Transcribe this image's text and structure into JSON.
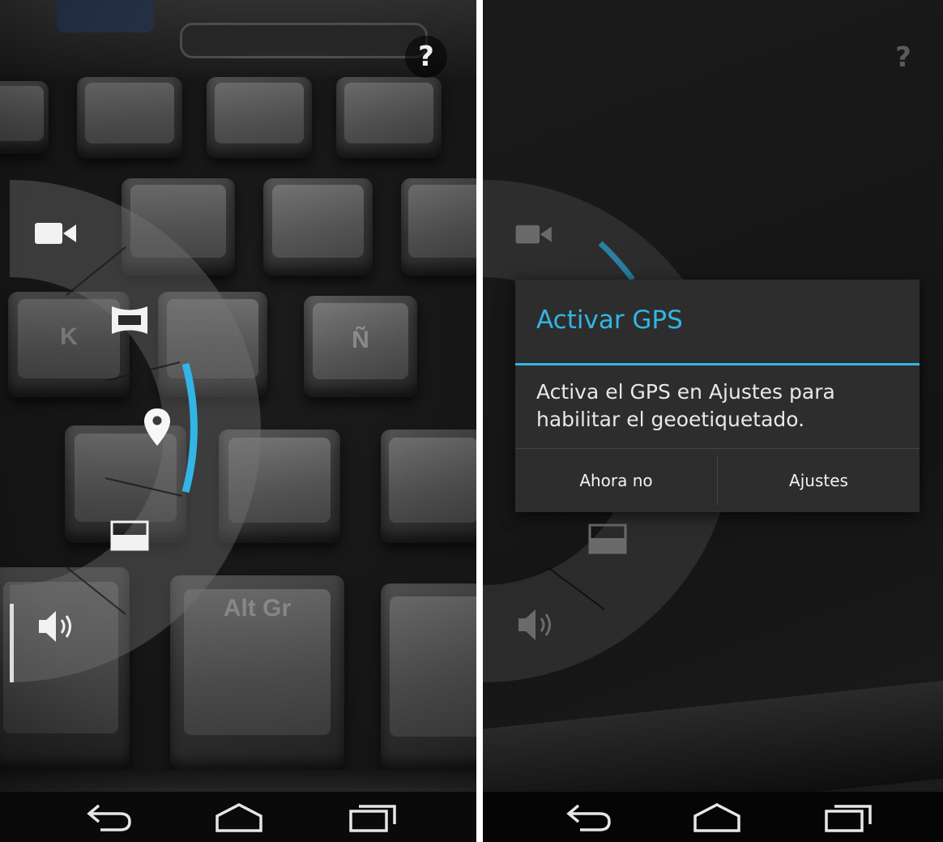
{
  "left_screen": {
    "help_label": "?",
    "keys": [
      "Alt Gr",
      "K",
      "Ñ"
    ],
    "menu_items": [
      {
        "name": "video-mode",
        "icon": "video-camera-icon"
      },
      {
        "name": "panorama-mode",
        "icon": "panorama-icon"
      },
      {
        "name": "geotag-toggle",
        "icon": "location-pin-icon",
        "active": true
      },
      {
        "name": "picture-size",
        "icon": "aspect-ratio-icon"
      },
      {
        "name": "shutter-sound",
        "icon": "speaker-icon"
      }
    ],
    "accent_color": "#33b5e5"
  },
  "right_screen": {
    "help_label": "?",
    "dialog": {
      "title": "Activar GPS",
      "message": "Activa el GPS en Ajustes para habilitar el geoetiquetado.",
      "negative_button": "Ahora no",
      "positive_button": "Ajustes"
    },
    "accent_color": "#33b5e5"
  },
  "navigation": {
    "buttons": [
      "back-icon",
      "home-icon",
      "recent-apps-icon"
    ]
  }
}
